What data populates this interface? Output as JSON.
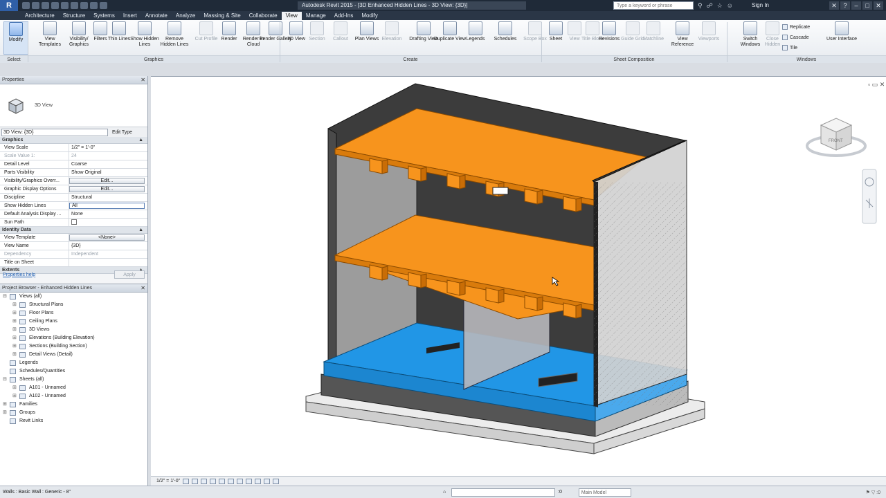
{
  "app": {
    "logo": "R",
    "doc_title": "Autodesk Revit 2015 - [3D Enhanced Hidden Lines - 3D View: {3D}]",
    "search_placeholder": "Type a keyword or phrase",
    "sign_in": "Sign In"
  },
  "tabs": [
    "Architecture",
    "Structure",
    "Systems",
    "Insert",
    "Annotate",
    "Analyze",
    "Massing & Site",
    "Collaborate",
    "View",
    "Manage",
    "Add-Ins",
    "Modify"
  ],
  "active_tab": "View",
  "ribbon": {
    "buttons": [
      {
        "id": "modify",
        "label": "Modify",
        "state": "sel"
      },
      {
        "id": "view-templates",
        "label": "View Templates"
      },
      {
        "id": "visibility-graphics",
        "label": "Visibility/ Graphics"
      },
      {
        "id": "filters",
        "label": "Filters"
      },
      {
        "id": "thin-lines",
        "label": "Thin Lines"
      },
      {
        "id": "show-hidden-lines",
        "label": "Show Hidden Lines"
      },
      {
        "id": "remove-hidden-lines",
        "label": "Remove Hidden Lines"
      },
      {
        "id": "cut-profile",
        "label": "Cut Profile",
        "state": "dim"
      },
      {
        "id": "render",
        "label": "Render"
      },
      {
        "id": "render-in-cloud",
        "label": "Render in Cloud"
      },
      {
        "id": "render-gallery",
        "label": "Render Gallery"
      },
      {
        "id": "3d-view",
        "label": "3D View"
      },
      {
        "id": "section",
        "label": "Section",
        "state": "dim"
      },
      {
        "id": "callout",
        "label": "Callout",
        "state": "dim"
      },
      {
        "id": "plan-views",
        "label": "Plan Views"
      },
      {
        "id": "elevation",
        "label": "Elevation",
        "state": "dim"
      },
      {
        "id": "drafting-view",
        "label": "Drafting View"
      },
      {
        "id": "duplicate-view",
        "label": "Duplicate View"
      },
      {
        "id": "legends",
        "label": "Legends"
      },
      {
        "id": "schedules",
        "label": "Schedules"
      },
      {
        "id": "scope-box",
        "label": "Scope Box",
        "state": "dim"
      },
      {
        "id": "sheet",
        "label": "Sheet"
      },
      {
        "id": "view",
        "label": "View",
        "state": "dim"
      },
      {
        "id": "title-block",
        "label": "Title Block",
        "state": "dim"
      },
      {
        "id": "revisions",
        "label": "Revisions"
      },
      {
        "id": "guide-grid",
        "label": "Guide Grid",
        "state": "dim"
      },
      {
        "id": "matchline",
        "label": "Matchline",
        "state": "dim"
      },
      {
        "id": "view-reference",
        "label": "View Reference"
      },
      {
        "id": "viewports",
        "label": "Viewports",
        "state": "dim"
      },
      {
        "id": "switch-windows",
        "label": "Switch Windows"
      },
      {
        "id": "close-hidden",
        "label": "Close Hidden",
        "state": "dim"
      },
      {
        "id": "user-interface",
        "label": "User Interface"
      }
    ],
    "window_small": [
      "Replicate",
      "Cascade",
      "Tile"
    ],
    "panels": [
      "Select",
      "Graphics",
      "Create",
      "Sheet Composition",
      "Windows"
    ]
  },
  "properties": {
    "title": "Properties",
    "type_name": "3D View",
    "instance": "3D View: {3D}",
    "edit_type": "Edit Type",
    "groups": [
      {
        "name": "Graphics",
        "rows": [
          {
            "k": "View Scale",
            "v": "1/2\" = 1'-0\""
          },
          {
            "k": "Scale Value 1:",
            "v": "24",
            "dim": true
          },
          {
            "k": "Detail Level",
            "v": "Coarse"
          },
          {
            "k": "Parts Visibility",
            "v": "Show Original"
          },
          {
            "k": "Visibility/Graphics Overr...",
            "v": "Edit...",
            "btn": true
          },
          {
            "k": "Graphic Display Options",
            "v": "Edit...",
            "btn": true
          },
          {
            "k": "Discipline",
            "v": "Structural"
          },
          {
            "k": "Show Hidden Lines",
            "v": "All",
            "box": true
          },
          {
            "k": "Default Analysis Display ...",
            "v": "None"
          },
          {
            "k": "Sun Path",
            "v": "",
            "check": true
          }
        ]
      },
      {
        "name": "Identity Data",
        "rows": [
          {
            "k": "View Template",
            "v": "<None>",
            "btn": true
          },
          {
            "k": "View Name",
            "v": "{3D}"
          },
          {
            "k": "Dependency",
            "v": "Independent",
            "dim": true
          },
          {
            "k": "Title on Sheet",
            "v": ""
          }
        ]
      },
      {
        "name": "Extents",
        "rows": []
      }
    ],
    "help_link": "Properties help",
    "apply": "Apply"
  },
  "browser": {
    "title": "Project Browser - Enhanced Hidden Lines",
    "items": [
      {
        "label": "Views (all)",
        "level": 0,
        "tog": "⊟"
      },
      {
        "label": "Structural Plans",
        "level": 1,
        "tog": "⊞"
      },
      {
        "label": "Floor Plans",
        "level": 1,
        "tog": "⊞"
      },
      {
        "label": "Ceiling Plans",
        "level": 1,
        "tog": "⊞"
      },
      {
        "label": "3D Views",
        "level": 1,
        "tog": "⊞"
      },
      {
        "label": "Elevations (Building Elevation)",
        "level": 1,
        "tog": "⊞"
      },
      {
        "label": "Sections (Building Section)",
        "level": 1,
        "tog": "⊞"
      },
      {
        "label": "Detail Views (Detail)",
        "level": 1,
        "tog": "⊞"
      },
      {
        "label": "Legends",
        "level": 0,
        "tog": ""
      },
      {
        "label": "Schedules/Quantities",
        "level": 0,
        "tog": ""
      },
      {
        "label": "Sheets (all)",
        "level": 0,
        "tog": "⊟"
      },
      {
        "label": "A101 - Unnamed",
        "level": 1,
        "tog": "⊞"
      },
      {
        "label": "A102 - Unnamed",
        "level": 1,
        "tog": "⊞"
      },
      {
        "label": "Families",
        "level": 0,
        "tog": "⊞"
      },
      {
        "label": "Groups",
        "level": 0,
        "tog": "⊞"
      },
      {
        "label": "Revit Links",
        "level": 0,
        "tog": ""
      }
    ]
  },
  "view_controls": {
    "scale": "1/2\" = 1'-0\""
  },
  "viewcube": {
    "face": "FRONT"
  },
  "status": {
    "message": "Walls : Basic Wall : Generic - 8\"",
    "coord": ":0",
    "model": "Main Model"
  },
  "colors": {
    "floor": "#f7941d",
    "base": "#1e90e0",
    "wall": "#9e9e9e",
    "dark_wall": "#3a3a3a",
    "highlight": "#1f5fb3"
  }
}
